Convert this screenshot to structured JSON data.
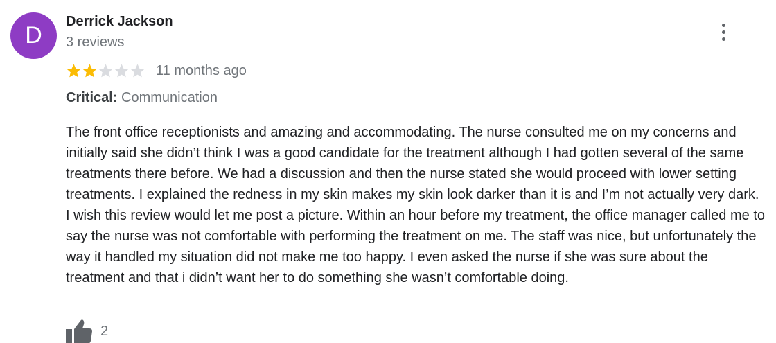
{
  "review": {
    "avatar_letter": "D",
    "author_name": "Derrick Jackson",
    "review_count": "3 reviews",
    "rating": 2,
    "max_rating": 5,
    "date": "11 months ago",
    "critical_label": "Critical:",
    "critical_value": "Communication",
    "text": "The front office receptionists and amazing and accommodating. The nurse consulted me on my concerns and initially said she didn’t think I was a good candidate for the treatment although I had gotten several of the same treatments there before. We had a discussion and then the nurse stated she would proceed with lower setting treatments. I explained the redness in my skin makes my skin look darker than it is and I’m not actually very dark. I wish this review would let me post a picture.  Within an hour before my treatment, the office manager called me to say the nurse was not comfortable with performing the treatment on me. The staff was nice, but unfortunately the way it handled my situation did not make me too happy. I even asked the nurse if she was sure about the treatment and that i didn’t want her to do something she wasn’t comfortable doing.",
    "like_count": "2"
  },
  "icons": {
    "more": "more-vert-icon",
    "like": "thumb-up-icon",
    "star": "star-icon"
  },
  "colors": {
    "avatar_bg": "#8e3cc4",
    "star_filled": "#fbbc04",
    "star_empty": "#dadce0",
    "muted_text": "#70757a",
    "icon": "#5f6368"
  }
}
